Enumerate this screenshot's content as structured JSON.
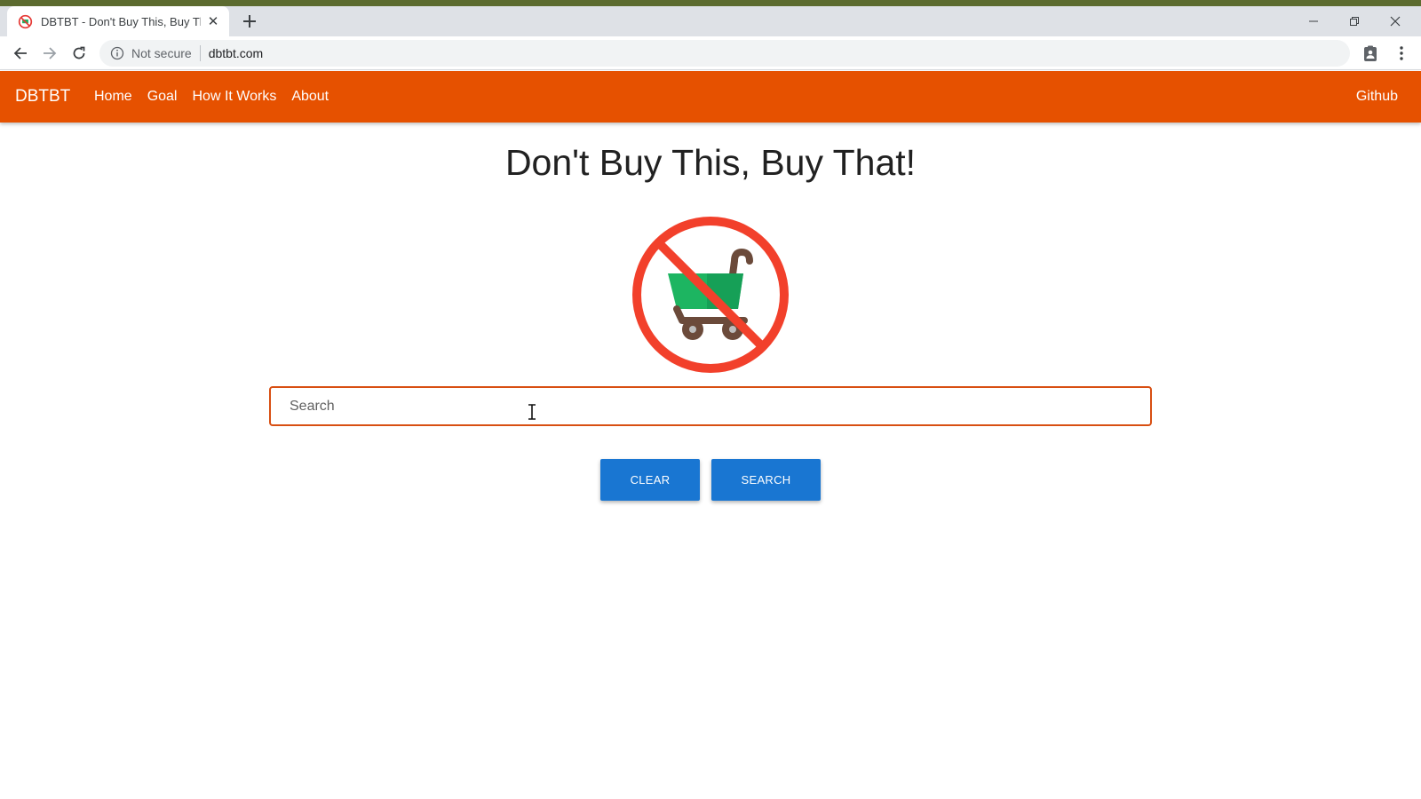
{
  "browser": {
    "tab_title": "DBTBT - Don't Buy This, Buy That",
    "new_tab_icon": "plus-icon",
    "security_label": "Not secure",
    "url": "dbtbt.com"
  },
  "navbar": {
    "brand": "DBTBT",
    "links": [
      "Home",
      "Goal",
      "How It Works",
      "About"
    ],
    "right_link": "Github",
    "color": "#e65100"
  },
  "main": {
    "title": "Don't Buy This, Buy That!",
    "logo_icon": "no-shopping-cart-icon",
    "search_placeholder": "Search",
    "clear_label": "CLEAR",
    "search_label": "SEARCH",
    "button_color": "#1976d2",
    "search_border_color": "#d84f12"
  }
}
